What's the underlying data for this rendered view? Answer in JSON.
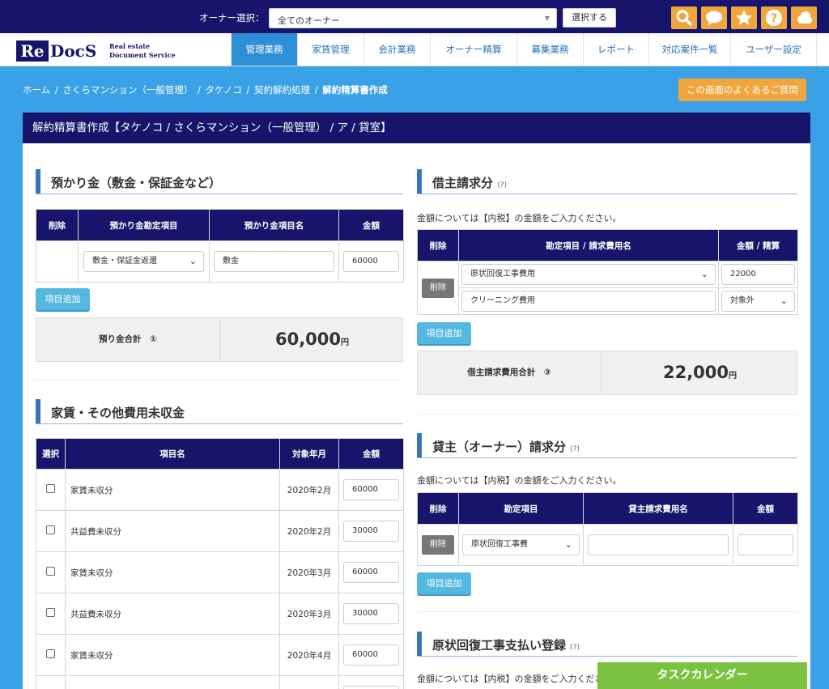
{
  "topbar": {
    "owner_label": "オーナー選択：",
    "owner_select_value": "全てのオーナー",
    "select_button": "選択する",
    "icons": [
      "search-icon",
      "chat-icon",
      "star-icon",
      "help-icon",
      "cloud-icon"
    ],
    "accent_color": "#f0a63c"
  },
  "logo": {
    "re": "Re",
    "docs": "DocS",
    "line1": "Real estate",
    "line2": "Document Service"
  },
  "nav": [
    "管理業務",
    "家賃管理",
    "会計業務",
    "オーナー精算",
    "募集業務",
    "レポート",
    "対応案件一覧",
    "ユーザー設定"
  ],
  "breadcrumb": {
    "items": [
      "ホーム",
      "さくらマンション（一般管理）",
      "タケノコ",
      "契約解約処理"
    ],
    "current": "解約精算書作成",
    "sep": "/"
  },
  "faq_button": "この画面のよくあるご質問",
  "page_title": "解約精算書作成【タケノコ / さくらマンション（一般管理） / ア / 貸室】",
  "deposit": {
    "title": "預かり金（敷金・保証金など）",
    "headers": [
      "削除",
      "預かり金勘定項目",
      "預かり金項目名",
      "金額"
    ],
    "row": {
      "account": "敷金・保証金返還",
      "name": "敷金",
      "amount": "60000"
    },
    "add_button": "項目追加",
    "total_label": "預り金合計　①",
    "total_value": "60,000",
    "yen": "円"
  },
  "arrears": {
    "title": "家賃・その他費用未収金",
    "headers": [
      "選択",
      "項目名",
      "対象年月",
      "金額"
    ],
    "rows": [
      {
        "name": "家賃未収分",
        "month": "2020年2月",
        "amount": "60000"
      },
      {
        "name": "共益費未収分",
        "month": "2020年2月",
        "amount": "30000"
      },
      {
        "name": "家賃未収分",
        "month": "2020年3月",
        "amount": "60000"
      },
      {
        "name": "共益費未収分",
        "month": "2020年3月",
        "amount": "30000"
      },
      {
        "name": "家賃未収分",
        "month": "2020年4月",
        "amount": "60000"
      }
    ]
  },
  "tenant_claim": {
    "title": "借主請求分",
    "help": "(?)",
    "note": "金額については【内税】の金額をご入力ください。",
    "headers": [
      "削除",
      "勘定項目 / 請求費用名",
      "金額 / 精算"
    ],
    "delete_button": "削除",
    "account": "原状回復工事費用",
    "amount": "22000",
    "item_name": "クリーニング費用",
    "settle": "対象外",
    "add_button": "項目追加",
    "total_label": "借主請求費用合計　③",
    "total_value": "22,000",
    "yen": "円"
  },
  "owner_claim": {
    "title": "貸主（オーナー）請求分",
    "help": "(?)",
    "note": "金額については【内税】の金額をご入力ください。",
    "headers": [
      "削除",
      "勘定項目",
      "貸主請求費用名",
      "金額"
    ],
    "delete_button": "削除",
    "account": "原状回復工事費",
    "name": "",
    "amount": "",
    "add_button": "項目追加"
  },
  "restoration": {
    "title": "原状回復工事支払い登録",
    "help": "(?)",
    "note": "金額については【内税】の金額をご入力ください。"
  },
  "task_calendar": "タスクカレンダー"
}
